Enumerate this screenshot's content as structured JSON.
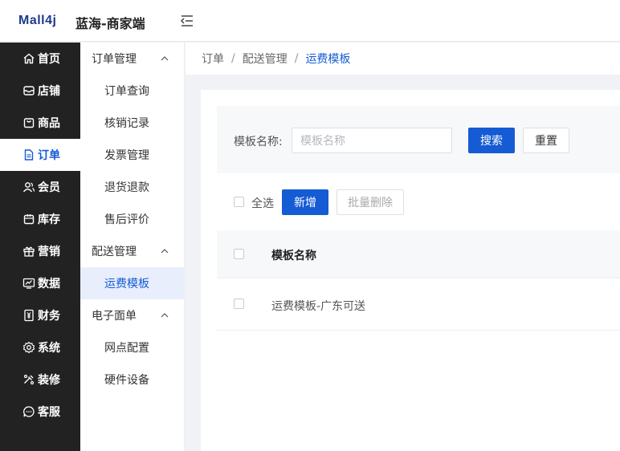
{
  "header": {
    "logo_text": "Mall",
    "logo_suffix": "4j",
    "app_title": "蓝海-商家端",
    "brand_color": "#1e3a8a"
  },
  "sidebar": {
    "items": [
      {
        "label": "首页",
        "icon": "home-icon"
      },
      {
        "label": "店铺",
        "icon": "shop-icon"
      },
      {
        "label": "商品",
        "icon": "bag-icon"
      },
      {
        "label": "订单",
        "icon": "document-icon",
        "active": true
      },
      {
        "label": "会员",
        "icon": "users-icon"
      },
      {
        "label": "库存",
        "icon": "inventory-icon"
      },
      {
        "label": "营销",
        "icon": "gift-icon"
      },
      {
        "label": "数据",
        "icon": "chart-icon"
      },
      {
        "label": "财务",
        "icon": "finance-icon"
      },
      {
        "label": "系统",
        "icon": "gear-icon"
      },
      {
        "label": "装修",
        "icon": "decorate-icon"
      },
      {
        "label": "客服",
        "icon": "chat-icon"
      }
    ]
  },
  "subsidebar": {
    "groups": [
      {
        "title": "订单管理",
        "items": [
          "订单查询",
          "核销记录",
          "发票管理",
          "退货退款",
          "售后评价"
        ]
      },
      {
        "title": "配送管理",
        "items": [
          "运费模板"
        ]
      },
      {
        "title": "电子面单",
        "items": [
          "网点配置",
          "硬件设备"
        ]
      }
    ],
    "active_item": "运费模板"
  },
  "breadcrumb": [
    "订单",
    "配送管理",
    "运费模板"
  ],
  "search": {
    "label": "模板名称:",
    "placeholder": "模板名称",
    "value": "",
    "search_button": "搜索",
    "reset_button": "重置"
  },
  "toolbar": {
    "select_all_label": "全选",
    "add_button": "新增",
    "batch_delete_button": "批量删除"
  },
  "table": {
    "columns": [
      "模板名称"
    ],
    "rows": [
      {
        "name": "运费模板-广东可送"
      }
    ]
  },
  "colors": {
    "accent": "#155bd4",
    "sidebar_bg": "#222222",
    "active_sub_bg": "#e8eefb"
  }
}
